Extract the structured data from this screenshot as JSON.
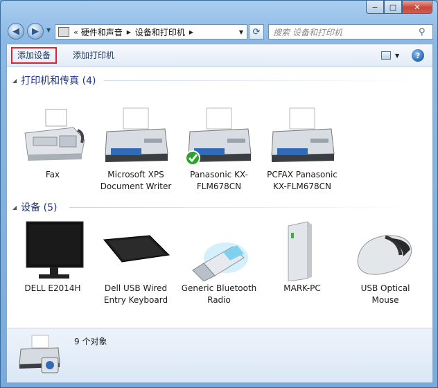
{
  "window": {
    "caption_buttons": {
      "minimize": "−",
      "maximize": "□",
      "close": "✕"
    }
  },
  "nav": {
    "back_glyph": "◀",
    "forward_glyph": "▶",
    "breadcrumb_sep": "«",
    "breadcrumbs": [
      "硬件和声音",
      "设备和打印机"
    ],
    "crumb_arrow": "▶",
    "dropdown_glyph": "▼",
    "refresh_glyph": "⟳",
    "search_placeholder": "搜索 设备和打印机",
    "search_icon": "⚲"
  },
  "toolbar": {
    "add_device": "添加设备",
    "add_printer": "添加打印机",
    "view_dropdown_glyph": "▼",
    "help_label": "?"
  },
  "groups": {
    "printers": {
      "title": "打印机和传真 (4)",
      "items": [
        {
          "label": "Fax",
          "icon": "fax-machine-icon"
        },
        {
          "label": "Microsoft XPS Document Writer",
          "icon": "printer-icon"
        },
        {
          "label": "Panasonic KX-FLM678CN",
          "icon": "printer-icon",
          "default": true
        },
        {
          "label": "PCFAX Panasonic KX-FLM678CN",
          "icon": "printer-icon"
        }
      ]
    },
    "devices": {
      "title": "设备 (5)",
      "items": [
        {
          "label": "DELL E2014H",
          "icon": "monitor-icon"
        },
        {
          "label": "Dell USB Wired Entry Keyboard",
          "icon": "keyboard-icon"
        },
        {
          "label": "Generic Bluetooth Radio",
          "icon": "usb-bluetooth-icon"
        },
        {
          "label": "MARK-PC",
          "icon": "computer-tower-icon"
        },
        {
          "label": "USB Optical Mouse",
          "icon": "mouse-icon"
        }
      ]
    },
    "collapse_glyph": "◢"
  },
  "details": {
    "count_text": "9 个对象"
  },
  "colors": {
    "group_title": "#1e3287",
    "highlight_border": "#d9232f",
    "check_green": "#2aa32a"
  }
}
